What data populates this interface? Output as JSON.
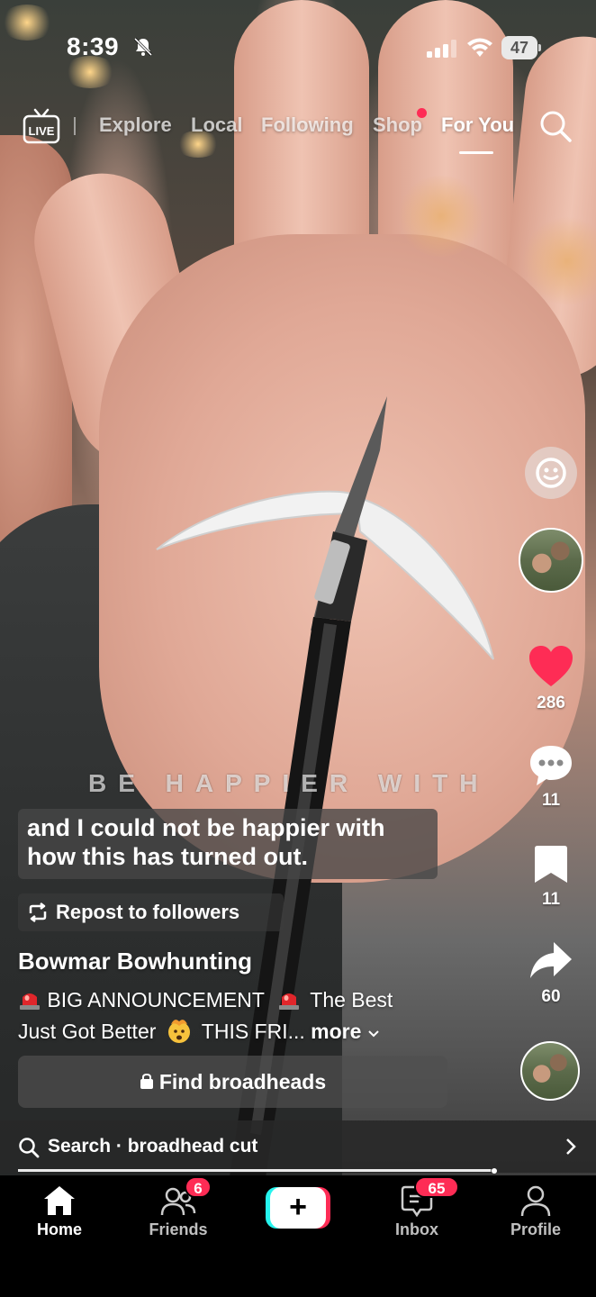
{
  "status_bar": {
    "time": "8:39",
    "battery": "47",
    "icons": [
      "bell-slash-icon",
      "cellular-signal-icon",
      "wifi-icon",
      "battery-icon"
    ]
  },
  "top_nav": {
    "live_label": "LIVE",
    "tabs": [
      {
        "label": "Explore",
        "active": false
      },
      {
        "label": "Local",
        "active": false
      },
      {
        "label": "Following",
        "active": false
      },
      {
        "label": "Shop",
        "active": false,
        "notification_dot": true
      },
      {
        "label": "For You",
        "active": true
      }
    ]
  },
  "video_overlay": {
    "spaced_text": "BE HAPPIER WITH",
    "caption_lines": [
      "and I could not be happier with",
      "how this has turned out."
    ]
  },
  "repost": {
    "label": "Repost to followers"
  },
  "post": {
    "author": "Bowmar Bowhunting",
    "description_line1_a": "BIG ANNOUNCEMENT",
    "description_line1_b": "The Best",
    "description_line2": "Just Got Better",
    "description_line2_b": "THIS FRI...",
    "more_label": "more"
  },
  "product_button": {
    "label": "Find broadheads"
  },
  "search_suggestion": {
    "label": "Search · broadhead cut"
  },
  "progress": 0.99,
  "right_rail": {
    "likes": "286",
    "comments": "11",
    "saves": "11",
    "shares": "60"
  },
  "bottom_nav": {
    "home": "Home",
    "friends": "Friends",
    "friends_badge": "6",
    "inbox": "Inbox",
    "inbox_badge": "65",
    "profile": "Profile"
  },
  "colors": {
    "accent_red": "#fe2c55",
    "accent_cyan": "#25f4ee",
    "like_red": "#fe2c55"
  }
}
